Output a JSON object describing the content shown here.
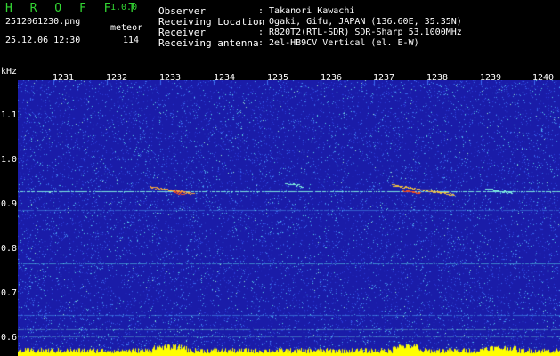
{
  "header": {
    "app_name": "H R O F F T",
    "app_version": "1.0.0",
    "file_name": "2512061230.png",
    "date_time": "25.12.06 12:30",
    "meteor_label": "meteor",
    "meteor_count": "114"
  },
  "info": [
    {
      "key": "Observer",
      "value": ": Takanori Kawachi"
    },
    {
      "key": "Receiving Location",
      "value": ": Ogaki, Gifu, JAPAN (136.60E, 35.35N)"
    },
    {
      "key": "Receiver",
      "value": ": R820T2(RTL-SDR) SDR-Sharp 53.1000MHz"
    },
    {
      "key": "Receiving antenna",
      "value": ": 2el-HB9CV Vertical (el. E-W)"
    }
  ],
  "axis": {
    "y_unit": "kHz",
    "x_ticks": [
      "1231",
      "1232",
      "1233",
      "1234",
      "1235",
      "1236",
      "1237",
      "1238",
      "1239",
      "1240"
    ],
    "y_ticks": [
      "1.1",
      "1.0",
      "0.9",
      "0.8",
      "0.7",
      "0.6"
    ]
  },
  "colors": {
    "background": "#000000",
    "spectrogram_base": "#1a1ca8",
    "title_green": "#33d633",
    "signal_cyan": "#7ff0e0",
    "level_yellow": "#ffff00"
  }
}
